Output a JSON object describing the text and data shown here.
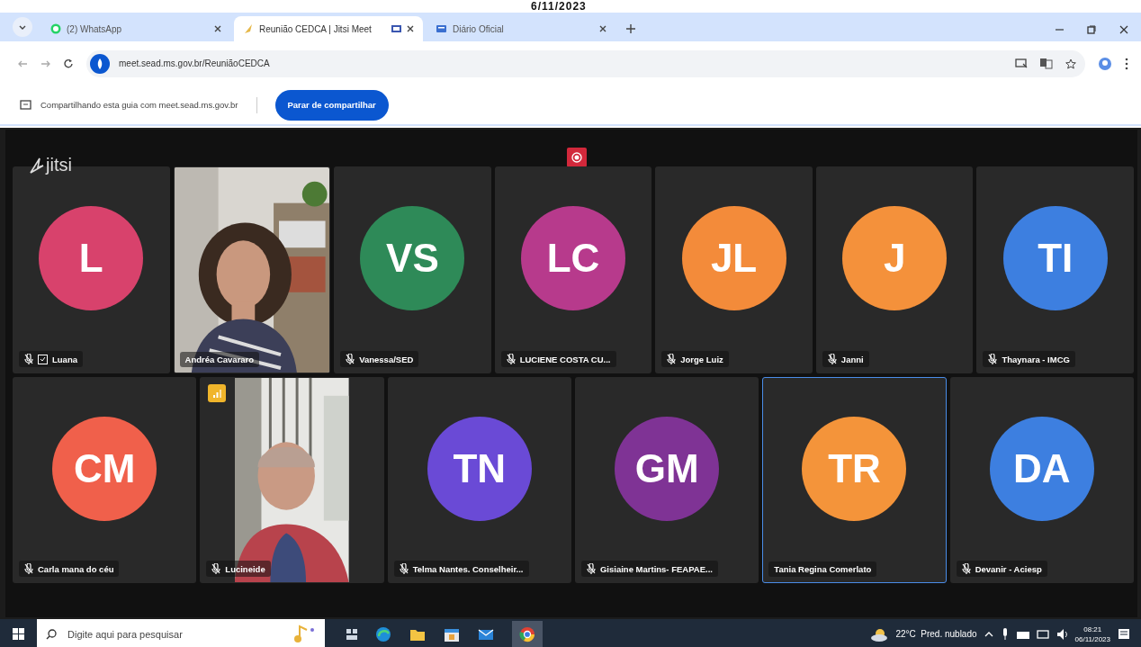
{
  "date_stamp": "6/11/2023",
  "browser": {
    "tabs": [
      {
        "label": "(2) WhatsApp",
        "selected": false
      },
      {
        "label": "Reunião CEDCA | Jitsi Meet",
        "selected": true
      },
      {
        "label": "Diário Oficial",
        "selected": false
      }
    ],
    "url": "meet.sead.ms.gov.br/ReuniãoCEDCA",
    "share_bar": {
      "message": "Compartilhando esta guia com meet.sead.ms.gov.br",
      "button": "Parar de compartilhar"
    }
  },
  "meeting": {
    "logo": "jitsi",
    "rows": [
      {
        "participants": [
          {
            "kind": "avatar",
            "initials": "L",
            "color": "#d8426c",
            "name": "Luana",
            "muted": true,
            "status_icon": true,
            "connection_warning": false,
            "speaking": false
          },
          {
            "kind": "video",
            "name": "Andréa Cavararo",
            "muted": false,
            "status_icon": false,
            "connection_warning": false,
            "speaking": false
          },
          {
            "kind": "avatar",
            "initials": "VS",
            "color": "#2e8a58",
            "name": "Vanessa/SED",
            "muted": true,
            "status_icon": false,
            "connection_warning": false,
            "speaking": false
          },
          {
            "kind": "avatar",
            "initials": "LC",
            "color": "#b73a8c",
            "name": "LUCIENE COSTA CU...",
            "muted": true,
            "status_icon": false,
            "connection_warning": false,
            "speaking": false
          },
          {
            "kind": "avatar",
            "initials": "JL",
            "color": "#f38b3a",
            "name": "Jorge Luiz",
            "muted": true,
            "status_icon": false,
            "connection_warning": false,
            "speaking": false
          },
          {
            "kind": "avatar",
            "initials": "J",
            "color": "#f4913b",
            "name": "Janni",
            "muted": true,
            "status_icon": false,
            "connection_warning": false,
            "speaking": false
          },
          {
            "kind": "avatar",
            "initials": "TI",
            "color": "#3d7fe0",
            "name": "Thaynara - IMCG",
            "muted": true,
            "status_icon": false,
            "connection_warning": false,
            "speaking": false
          }
        ]
      },
      {
        "participants": [
          {
            "kind": "avatar",
            "initials": "CM",
            "color": "#f0604b",
            "name": "Carla mana do céu",
            "muted": true,
            "status_icon": false,
            "connection_warning": false,
            "speaking": false
          },
          {
            "kind": "video_portrait",
            "name": "Lucineide",
            "muted": true,
            "status_icon": false,
            "connection_warning": true,
            "speaking": false
          },
          {
            "kind": "avatar",
            "initials": "TN",
            "color": "#6a4ad6",
            "name": "Telma Nantes. Conselheir...",
            "muted": true,
            "status_icon": false,
            "connection_warning": false,
            "speaking": false
          },
          {
            "kind": "avatar",
            "initials": "GM",
            "color": "#7f3395",
            "name": "Gisiaine Martins- FEAPAE...",
            "muted": true,
            "status_icon": false,
            "connection_warning": false,
            "speaking": false
          },
          {
            "kind": "avatar",
            "initials": "TR",
            "color": "#f4943a",
            "name": "Tania Regina Comerlato",
            "muted": false,
            "status_icon": false,
            "connection_warning": false,
            "speaking": true
          },
          {
            "kind": "avatar",
            "initials": "DA",
            "color": "#3d7fe0",
            "name": "Devanir - Aciesp",
            "muted": true,
            "status_icon": false,
            "connection_warning": false,
            "speaking": false
          }
        ]
      }
    ]
  },
  "taskbar": {
    "search_placeholder": "Digite aqui para pesquisar",
    "weather": "22°C  Pred. nublado",
    "time": "08:21",
    "date": "06/11/2023"
  }
}
